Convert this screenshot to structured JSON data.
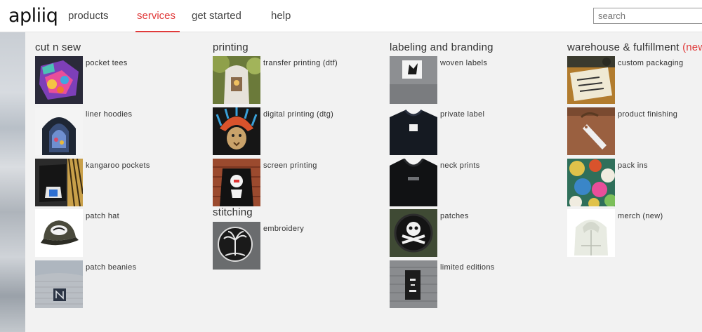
{
  "header": {
    "logo": "apliiq",
    "nav": [
      "products",
      "services",
      "get started",
      "help"
    ],
    "search_placeholder": "search"
  },
  "columns": [
    {
      "title": "cut n sew",
      "items": [
        "pocket tees",
        "liner hoodies",
        "kangaroo pockets",
        "patch hat",
        "patch beanies"
      ]
    },
    {
      "title": "printing",
      "items": [
        "transfer printing (dtf)",
        "digital printing (dtg)",
        "screen printing"
      ],
      "subtitle": "stitching",
      "sub_items": [
        "embroidery"
      ]
    },
    {
      "title": "labeling and branding",
      "items": [
        "woven labels",
        "private label",
        "neck prints",
        "patches",
        "limited editions"
      ]
    },
    {
      "title": "warehouse & fulfillment",
      "title_suffix": "(new",
      "items": [
        "custom packaging",
        "product finishing",
        "pack ins",
        "merch (new)"
      ]
    }
  ],
  "colors": {
    "accent": "#e03a3a"
  }
}
